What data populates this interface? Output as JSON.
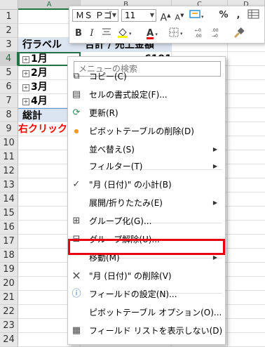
{
  "columns": [
    "A",
    "B",
    "C",
    "D"
  ],
  "rows": [
    "1",
    "2",
    "3",
    "4",
    "5",
    "6",
    "7",
    "8",
    "9",
    "10",
    "11",
    "12",
    "13",
    "14",
    "15",
    "16",
    "17",
    "18",
    "19",
    "20",
    "21",
    "22",
    "23",
    "24"
  ],
  "pivot": {
    "row_label_header": "行ラベル",
    "value_header": "合計 / 売上金額",
    "first_value": "6191",
    "items": [
      "1月",
      "2月",
      "3月",
      "4月"
    ],
    "total_label": "総計"
  },
  "annotation": "右クリック",
  "toolbar": {
    "font_name": "ＭＳ Ｐゴ",
    "font_size": "11",
    "grow_font": "A",
    "shrink_font": "A",
    "percent": "%",
    "comma": ",",
    "bold": "B",
    "italic": "I",
    "font_color": "A"
  },
  "menu": {
    "search_placeholder": "メニューの検索",
    "items": [
      {
        "label": "コピー(C)",
        "icon": "copy-icon"
      },
      {
        "label": "セルの書式設定(F)...",
        "icon": "format-cells-icon"
      },
      {
        "label": "更新(R)",
        "icon": "refresh-icon"
      },
      {
        "label": "ピボットテーブルの削除(D)",
        "icon": "bullet-icon"
      },
      {
        "label": "並べ替え(S)",
        "icon": ""
      },
      {
        "label": "フィルター(T)",
        "icon": ""
      },
      {
        "label": "\"月 (日付)\" の小計(B)",
        "icon": "checkmark-icon"
      },
      {
        "label": "展開/折りたたみ(E)",
        "icon": ""
      },
      {
        "label": "グループ化(G)...",
        "icon": "group-icon"
      },
      {
        "label": "グループ解除(U)...",
        "icon": "ungroup-icon"
      },
      {
        "label": "移動(M)",
        "icon": ""
      },
      {
        "label": "\"月 (日付)\" の削除(V)",
        "icon": "delete-x-icon"
      },
      {
        "label": "フィールドの設定(N)...",
        "icon": "field-settings-icon"
      },
      {
        "label": "ピボットテーブル オプション(O)...",
        "icon": ""
      },
      {
        "label": "フィールド リストを表示しない(D)",
        "icon": "field-list-icon"
      }
    ]
  },
  "colors": {
    "accent": "#217346",
    "highlight": "#e60012",
    "annotation": "#ff0000",
    "pivot_header": "#dbe5f1"
  }
}
